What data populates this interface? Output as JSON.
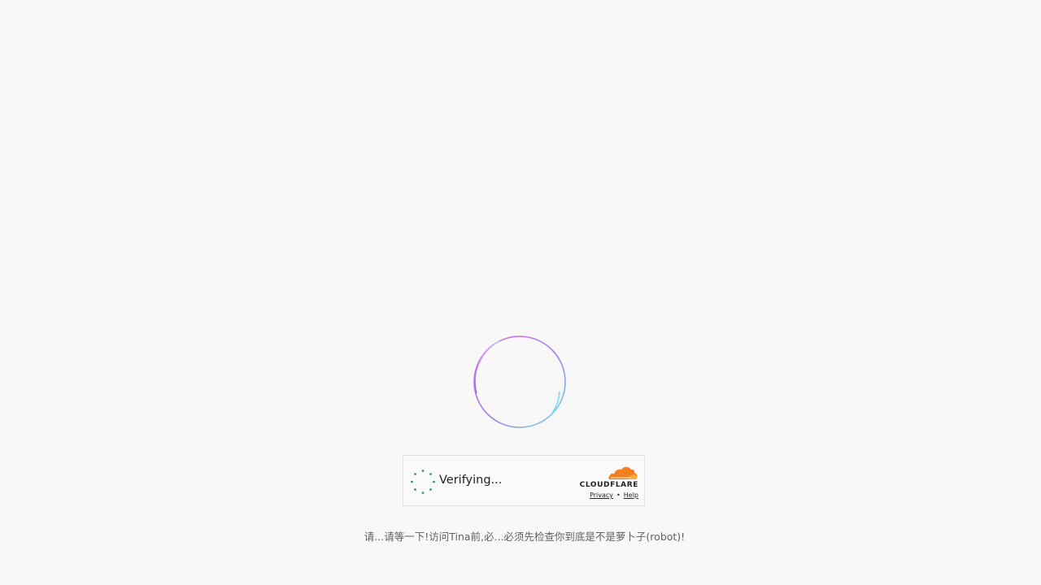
{
  "widget": {
    "status_text": "Verifying...",
    "brand_name": "CLOUDFLARE",
    "privacy_label": "Privacy",
    "separator": "•",
    "help_label": "Help"
  },
  "message": "请...请等一下!访问Tina前,必...必须先检查你到底是不是萝卜子(robot)!",
  "colors": {
    "background": "#f8f8f8",
    "spinner_dots": "#1a8a5a",
    "cloudflare_orange": "#f38020",
    "cloudflare_light_orange": "#faae40",
    "ring_gradient": [
      "#e96be8",
      "#9a7cf0",
      "#6fe0f5"
    ]
  },
  "icons": {
    "loader": "gradient-ring-loader-icon",
    "spinner": "dotted-spinner-icon",
    "logo": "cloudflare-cloud-icon"
  }
}
